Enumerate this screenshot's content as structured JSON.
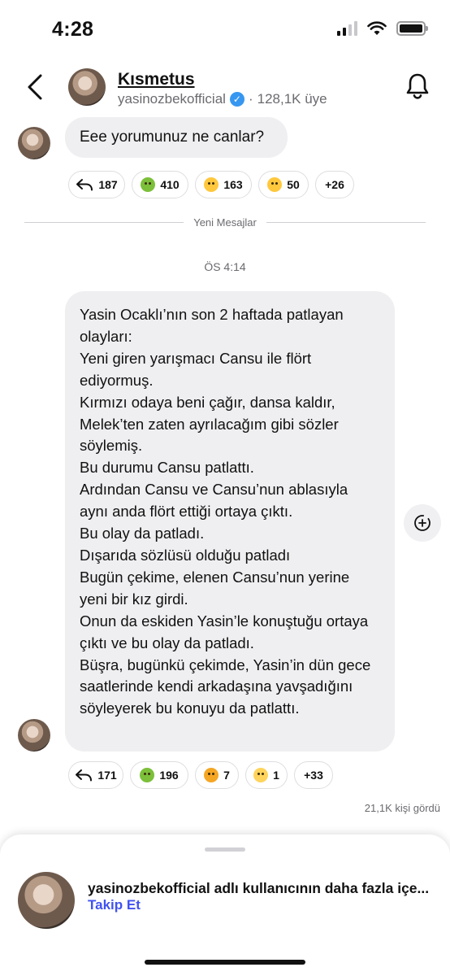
{
  "status_bar": {
    "time": "4:28"
  },
  "header": {
    "title": "Kısmetus",
    "username": "yasinozbekofficial",
    "members": "128,1K üye"
  },
  "message1": {
    "text": "Eee yorumunuz ne canlar?",
    "reactions": [
      {
        "icon": "reply-icon",
        "count": "187"
      },
      {
        "icon": "sick-face-emoji",
        "count": "410"
      },
      {
        "icon": "surprised-face-emoji",
        "count": "163"
      },
      {
        "icon": "laughing-face-emoji",
        "count": "50"
      },
      {
        "icon": "",
        "count": "+26"
      }
    ]
  },
  "divider": {
    "label": "Yeni Mesajlar"
  },
  "timestamp": "ÖS 4:14",
  "message2": {
    "text": "Yasin Ocaklı’nın son 2 haftada patlayan olayları:\nYeni giren yarışmacı Cansu ile flört ediyormuş.\nKırmızı odaya beni çağır, dansa kaldır, Melek’ten zaten ayrılacağım gibi sözler söylemiş.\nBu durumu Cansu patlattı.\nArdından Cansu ve Cansu’nun ablasıyla aynı anda flört ettiği ortaya çıktı.\nBu olay da patladı.\nDışarıda sözlüsü olduğu patladı\nBugün çekime, elenen Cansu’nun yerine yeni bir kız girdi.\nOnun da eskiden Yasin’le konuştuğu ortaya çıktı ve bu olay da patladı.\nBüşra, bugünkü çekimde, Yasin’in dün gece saatlerinde kendi arkadaşına yavşadığını söyleyerek bu konuyu da patlattı.",
    "reactions": [
      {
        "icon": "reply-icon",
        "count": "171"
      },
      {
        "icon": "sick-face-emoji",
        "count": "196"
      },
      {
        "icon": "mind-blown-emoji",
        "count": "7"
      },
      {
        "icon": "sad-face-emoji",
        "count": "1"
      },
      {
        "icon": "",
        "count": "+33"
      }
    ],
    "seen": "21,1K kişi gördü"
  },
  "sheet": {
    "text": "yasinozbekofficial adlı kullanıcının daha fazla içe...",
    "follow_label": "Takip Et"
  },
  "colors": {
    "accent": "#4152f0",
    "verified": "#3797f0",
    "bubble": "#efeff1"
  }
}
